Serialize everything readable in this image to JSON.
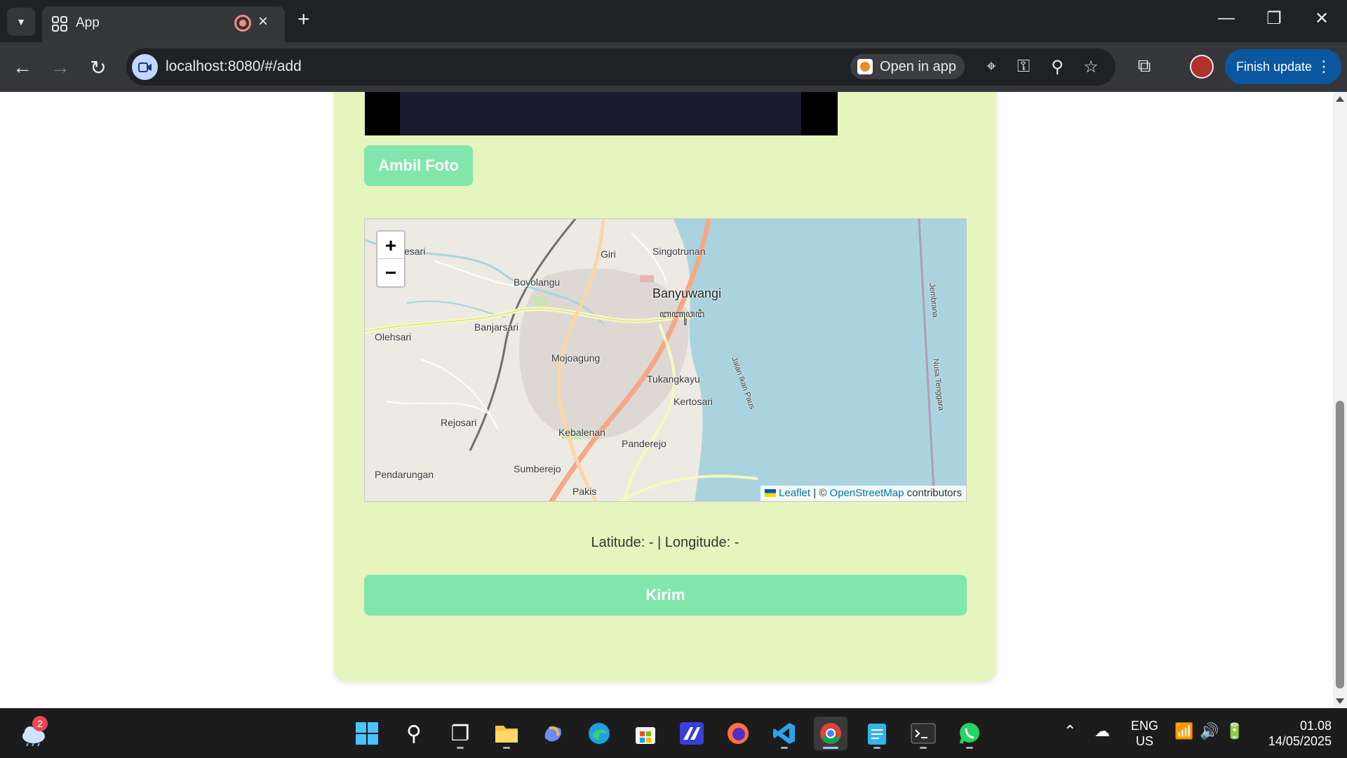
{
  "browser": {
    "tab_title": "App",
    "url": "localhost:8080/#/add",
    "open_in_app": "Open in app",
    "finish_update": "Finish update"
  },
  "page": {
    "capture_button": "Ambil Foto",
    "coords_text": "Latitude: - | Longitude: -",
    "submit_button": "Kirim"
  },
  "map": {
    "zoom_in": "+",
    "zoom_out": "−",
    "labels": {
      "pesari": "esari",
      "giri": "Giri",
      "singotrunan": "Singotrunan",
      "boyolangu": "Boyolangu",
      "banyuwangi": "Banyuwangi",
      "banyuwangi_script": "ꦧꦚꦸꦮꦔꦶ",
      "banjarsari": "Banjarsari",
      "olehsari": "Olehsari",
      "mojoagung": "Mojoagung",
      "tukangkayu": "Tukangkayu",
      "kertosari": "Kertosari",
      "rejosari": "Rejosari",
      "kebalenan": "Kebalenan",
      "panderejo": "Panderejo",
      "sumberejo": "Sumberejo",
      "pendarungan": "Pendarungan",
      "pakis": "Pakis",
      "jembrana": "Jembrana",
      "nusa_tenggara": "Nusa Tenggara",
      "jalan_ikan_paus": "Jalan Ikan Paus"
    },
    "attribution": {
      "leaflet": "Leaflet",
      "separator": "| ©",
      "osm": "OpenStreetMap",
      "contributors": "contributors"
    }
  },
  "taskbar": {
    "weather_badge": "2",
    "lang_top": "ENG",
    "lang_bottom": "US",
    "time": "01.08",
    "date": "14/05/2025"
  },
  "colors": {
    "card_bg": "#e6f5bd",
    "button_bg": "#80e6ac",
    "sea": "#aad3df",
    "update_button": "#0b57a0"
  }
}
